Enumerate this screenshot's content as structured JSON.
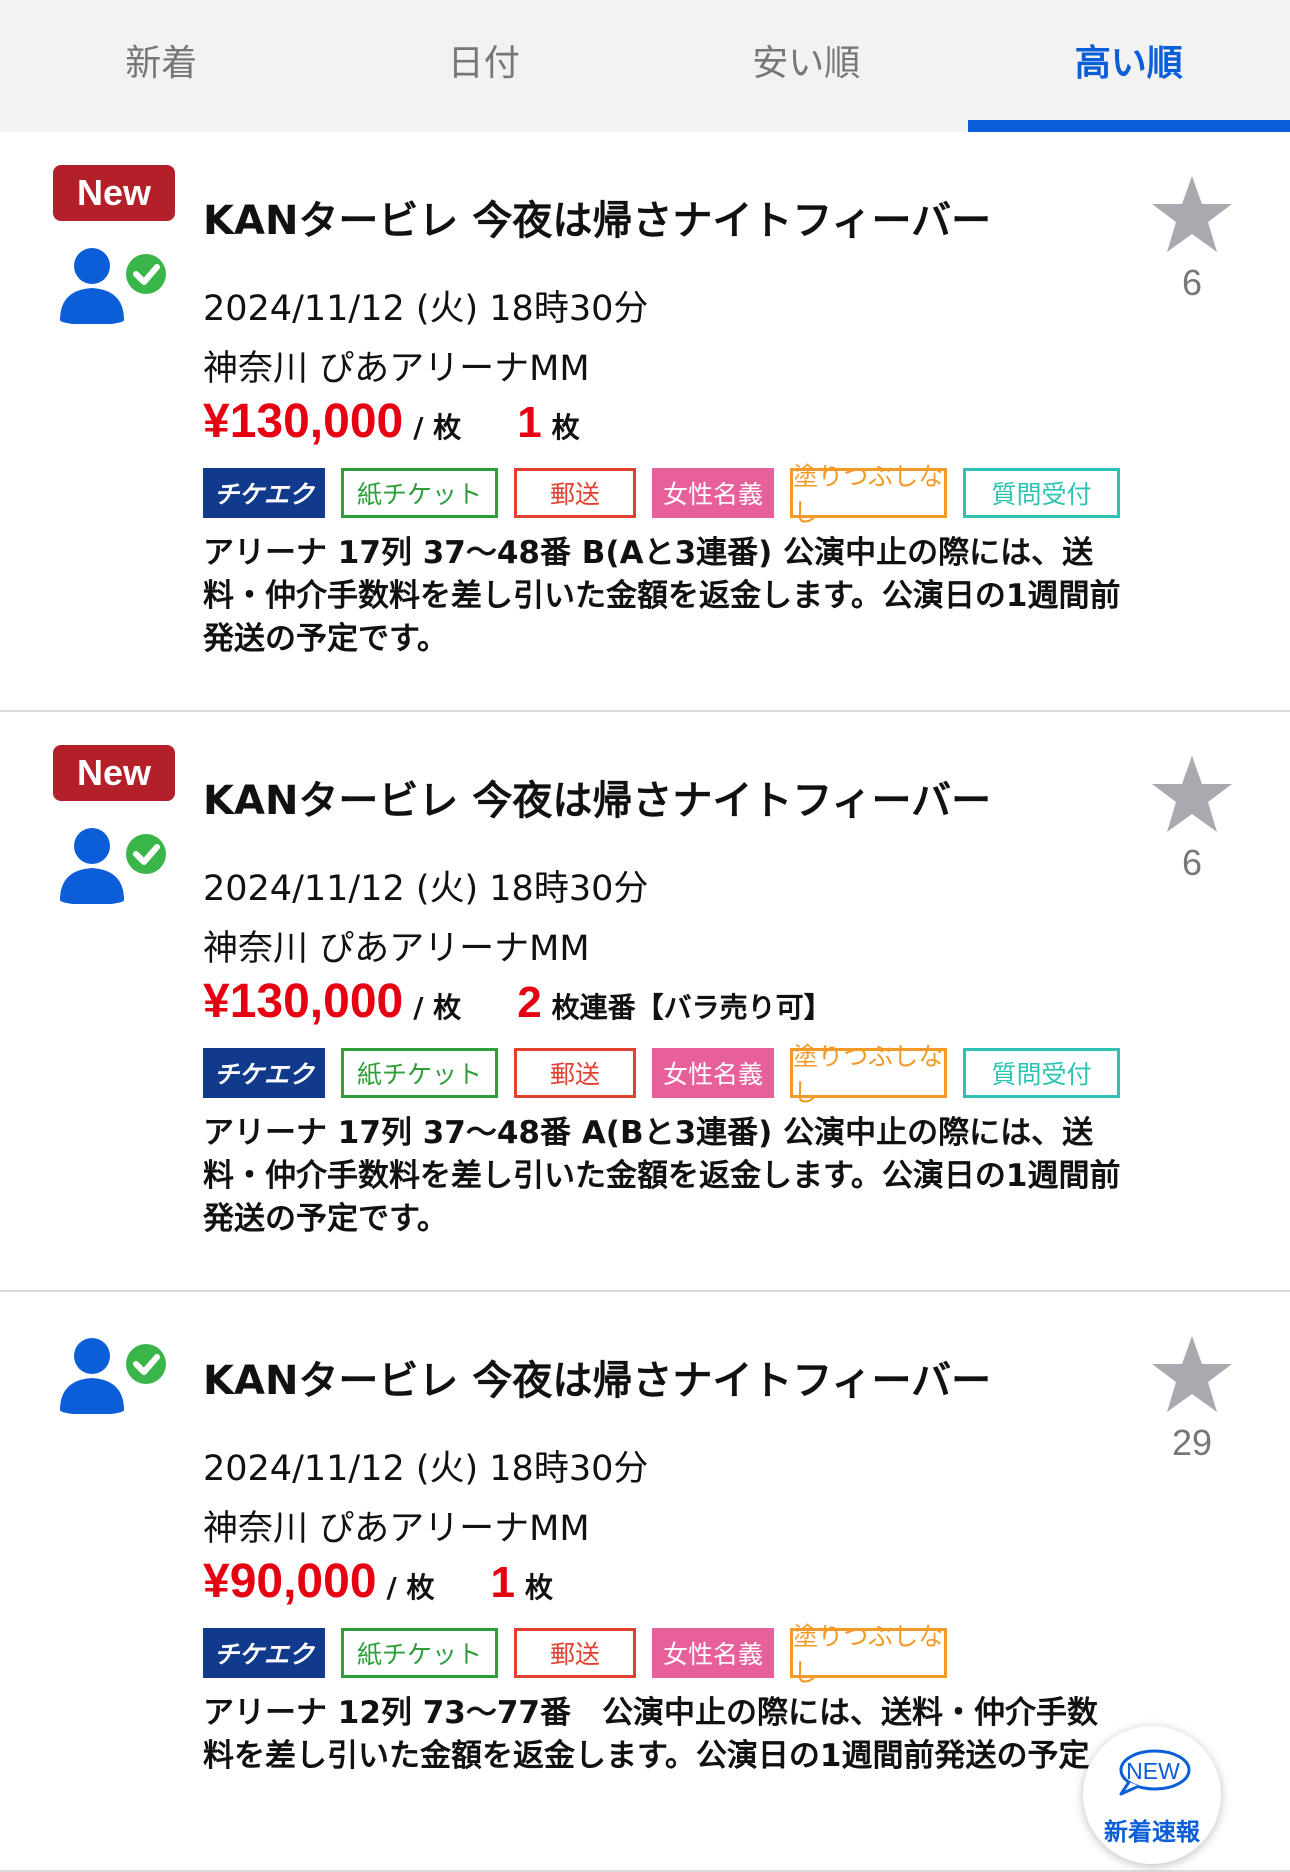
{
  "tabs": [
    {
      "label": "新着"
    },
    {
      "label": "日付"
    },
    {
      "label": "安い順"
    },
    {
      "label": "高い順"
    }
  ],
  "listings": [
    {
      "new_label": "New",
      "title": "KANタービレ 今夜は帰さナイトフィーバー",
      "date": "2024/11/12 (火) 18時30分",
      "venue": "神奈川 ぴあアリーナMM",
      "price": "¥130,000",
      "per_unit": "/ 枚",
      "quantity": "1",
      "quantity_unit": "枚",
      "tags": [
        "チケエク",
        "紙チケット",
        "郵送",
        "女性名義",
        "塗りつぶしなし",
        "質問受付"
      ],
      "description": "アリーナ 17列 37〜48番 B(Aと3連番) 公演中止の際には、送料・仲介手数料を差し引いた金額を返金します。公演日の1週間前発送の予定です。",
      "favorites": "6"
    },
    {
      "new_label": "New",
      "title": "KANタービレ 今夜は帰さナイトフィーバー",
      "date": "2024/11/12 (火) 18時30分",
      "venue": "神奈川 ぴあアリーナMM",
      "price": "¥130,000",
      "per_unit": "/ 枚",
      "quantity": "2",
      "quantity_unit": "枚連番【バラ売り可】",
      "tags": [
        "チケエク",
        "紙チケット",
        "郵送",
        "女性名義",
        "塗りつぶしなし",
        "質問受付"
      ],
      "description": "アリーナ 17列 37〜48番 A(Bと3連番) 公演中止の際には、送料・仲介手数料を差し引いた金額を返金します。公演日の1週間前発送の予定です。",
      "favorites": "6"
    },
    {
      "title": "KANタービレ 今夜は帰さナイトフィーバー",
      "date": "2024/11/12 (火) 18時30分",
      "venue": "神奈川 ぴあアリーナMM",
      "price": "¥90,000",
      "per_unit": "/ 枚",
      "quantity": "1",
      "quantity_unit": "枚",
      "tags": [
        "チケエク",
        "紙チケット",
        "郵送",
        "女性名義",
        "塗りつぶしなし"
      ],
      "description": "アリーナ 12列 73〜77番　公演中止の際には、送料・仲介手数料を差し引いた金額を返金します。公演日の1週間前発送の予定",
      "favorites": "29"
    }
  ],
  "fab": {
    "badge": "NEW",
    "label": "新着速報"
  },
  "colors": {
    "accent_blue": "#0b5ed7",
    "price_red": "#e50012",
    "new_badge": "#b3202a",
    "icon_blue": "#0b5ed7",
    "check_green": "#3ab54a",
    "star_gray": "#a9a9b0"
  }
}
